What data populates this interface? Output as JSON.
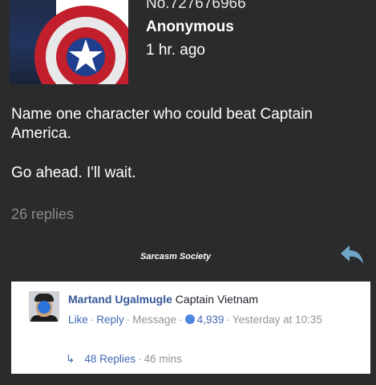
{
  "post": {
    "id": "No.727676966",
    "author": "Anonymous",
    "time": "1 hr. ago",
    "question": "Name one character who could beat Captain America.",
    "followup": "Go ahead. I'll wait.",
    "replies": "26 replies",
    "watermark": "Sarcasm Society",
    "thumbnail_icon": "captain-america-shield-image",
    "reply_icon": "reply-arrow-icon",
    "accent_color": "#6fa6c7"
  },
  "comment": {
    "author": "Martand Ugalmugle",
    "text": "Captain Vietnam",
    "like": "Like",
    "reply": "Reply",
    "message": "Message",
    "like_count": "4,939",
    "time": "Yesterday at 10:35",
    "replies": "48 Replies",
    "replies_age": "46 mins",
    "link_color": "#4267b2"
  }
}
